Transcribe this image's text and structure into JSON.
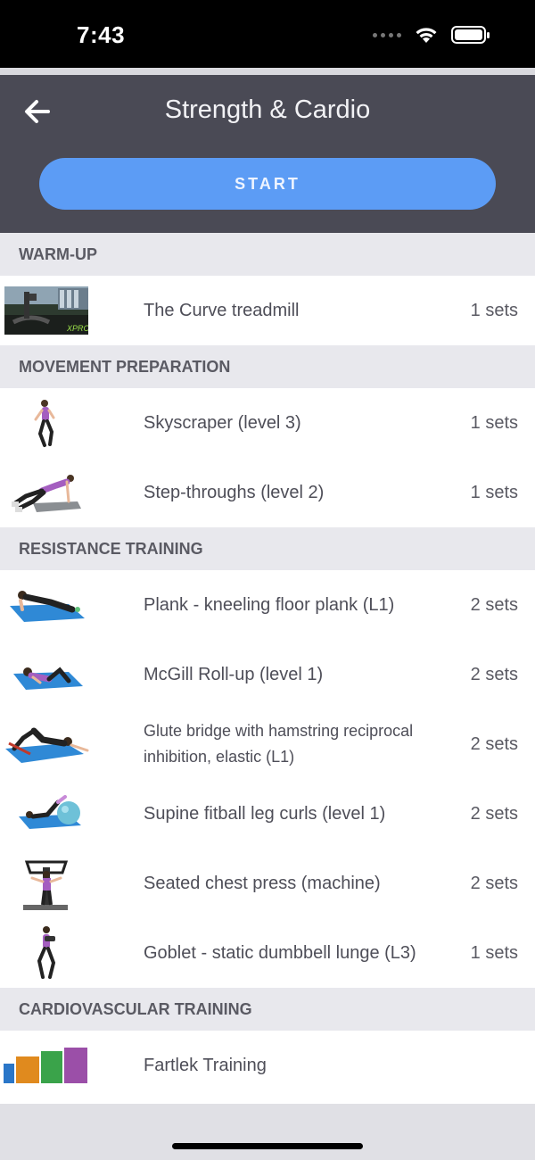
{
  "status_bar": {
    "time": "7:43"
  },
  "header": {
    "title": "Strength & Cardio",
    "start_label": "START"
  },
  "sections": {
    "warmup": "WARM-UP",
    "movement": "MOVEMENT PREPARATION",
    "resistance": "RESISTANCE TRAINING",
    "cardio": "CARDIOVASCULAR TRAINING"
  },
  "exercises": {
    "curve_treadmill": {
      "name": "The Curve treadmill",
      "sets": "1 sets"
    },
    "skyscraper": {
      "name": "Skyscraper (level 3)",
      "sets": "1 sets"
    },
    "step_throughs": {
      "name": "Step-throughs (level 2)",
      "sets": "1 sets"
    },
    "plank": {
      "name": "Plank - kneeling floor plank (L1)",
      "sets": "2 sets"
    },
    "mcgill": {
      "name": "McGill Roll-up (level 1)",
      "sets": "2 sets"
    },
    "glute_bridge": {
      "name": "Glute bridge with hamstring reciprocal inhibition, elastic (L1)",
      "sets": "2 sets"
    },
    "fitball": {
      "name": "Supine fitball leg curls (level 1)",
      "sets": "2 sets"
    },
    "chest_press": {
      "name": "Seated chest press (machine)",
      "sets": "2 sets"
    },
    "goblet": {
      "name": "Goblet - static dumbbell lunge (L3)",
      "sets": "1 sets"
    },
    "fartlek": {
      "name": "Fartlek Training",
      "sets": ""
    }
  },
  "icons": {
    "back": "arrow-left-icon",
    "wifi": "wifi-icon",
    "battery": "battery-icon",
    "cellular": "cellular-signal-icon"
  },
  "colors": {
    "header_bg": "#4a4a55",
    "start_button": "#5c9cf5",
    "section_bg": "#e8e8ed"
  }
}
